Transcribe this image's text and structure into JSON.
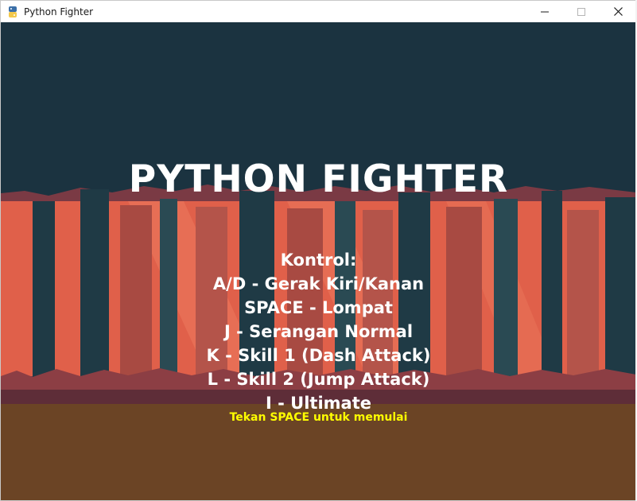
{
  "window": {
    "title": "Python Fighter",
    "app_icon": "python-icon",
    "controls": {
      "minimize_icon": "minimize-icon",
      "maximize_icon": "maximize-icon",
      "close_icon": "close-icon"
    }
  },
  "game": {
    "title": "PYTHON FIGHTER",
    "controls": [
      "Kontrol:",
      "A/D - Gerak Kiri/Kanan",
      "SPACE - Lompat",
      "J - Serangan Normal",
      "K - Skill 1 (Dash Attack)",
      "L - Skill 2 (Jump Attack)",
      "I - Ultimate"
    ],
    "start_prompt": "Tekan SPACE untuk memulai"
  },
  "colors": {
    "sky": "#1b3340",
    "forest_light": "#e0604a",
    "forest_mid": "#a84a42",
    "forest_dark": "#6e3540",
    "ground": "#6b4425",
    "title_text": "#ffffff",
    "prompt_text": "#ffff00"
  }
}
